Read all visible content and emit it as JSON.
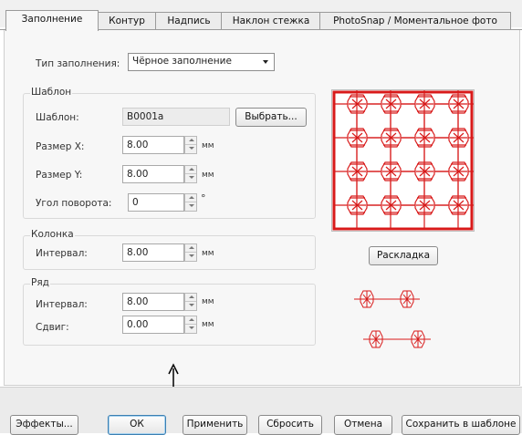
{
  "tabs": [
    "Заполнение",
    "Контур",
    "Надпись",
    "Наклон стежка",
    "PhotoSnap / Моментальное фото"
  ],
  "fill_type": {
    "label": "Тип заполнения:",
    "value": "Чёрное заполнение"
  },
  "template": {
    "group_label": "Шаблон",
    "name_label": "Шаблон:",
    "name_value": "B0001a",
    "select_button": "Выбрать...",
    "size_x_label": "Размер X:",
    "size_x_value": "8.00",
    "size_y_label": "Размер Y:",
    "size_y_value": "8.00",
    "angle_label": "Угол поворота:",
    "angle_value": "0",
    "unit_mm": "мм",
    "unit_deg": "°"
  },
  "column": {
    "group_label": "Колонка",
    "interval_label": "Интервал:",
    "interval_value": "8.00"
  },
  "row": {
    "group_label": "Ряд",
    "interval_label": "Интервал:",
    "interval_value": "8.00",
    "shift_label": "Сдвиг:",
    "shift_value": "0.00"
  },
  "layout_button": "Раскладка",
  "bottom_buttons": {
    "effects": "Эффекты...",
    "ok": "ОК",
    "apply": "Применить",
    "reset": "Сбросить",
    "cancel": "Отмена",
    "save_template": "Сохранить в шаблоне"
  },
  "colors": {
    "stitch_red": "#d81a1a",
    "accent_blue": "#3c7fb1"
  }
}
